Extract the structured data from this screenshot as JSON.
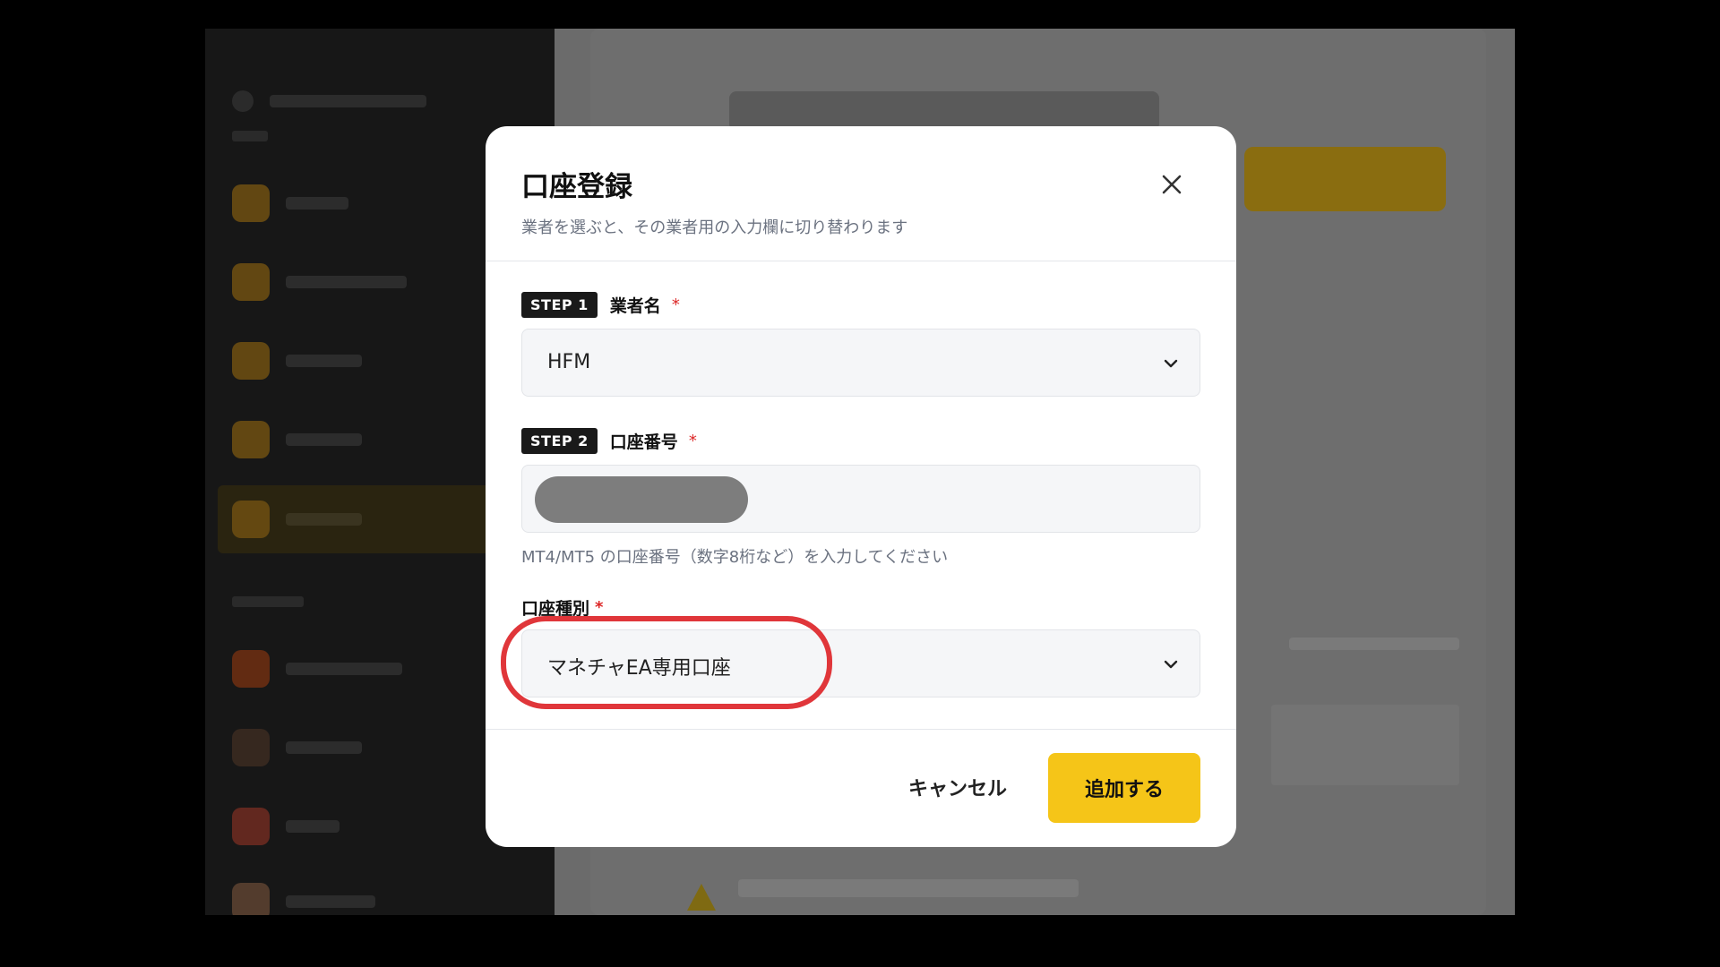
{
  "modal": {
    "title": "口座登録",
    "subtitle": "業者を選ぶと、その業者用の入力欄に切り替わります",
    "step1": {
      "badge": "STEP 1",
      "label": "業者名",
      "required_mark": "*",
      "selected_value": "HFM"
    },
    "step2": {
      "badge": "STEP 2",
      "label": "口座番号",
      "required_mark": "*",
      "hint": "MT4/MT5 の口座番号（数字8桁など）を入力してください"
    },
    "account_type": {
      "label": "口座種別",
      "required_mark": "*",
      "selected_value": "マネチャEA専用口座"
    },
    "buttons": {
      "cancel": "キャンセル",
      "submit": "追加する"
    }
  },
  "colors": {
    "accent": "#f5c518",
    "highlight": "#e0363a",
    "required": "#dc2626"
  },
  "icons": {
    "close": "close-icon",
    "select": "chevron-down-icon"
  }
}
